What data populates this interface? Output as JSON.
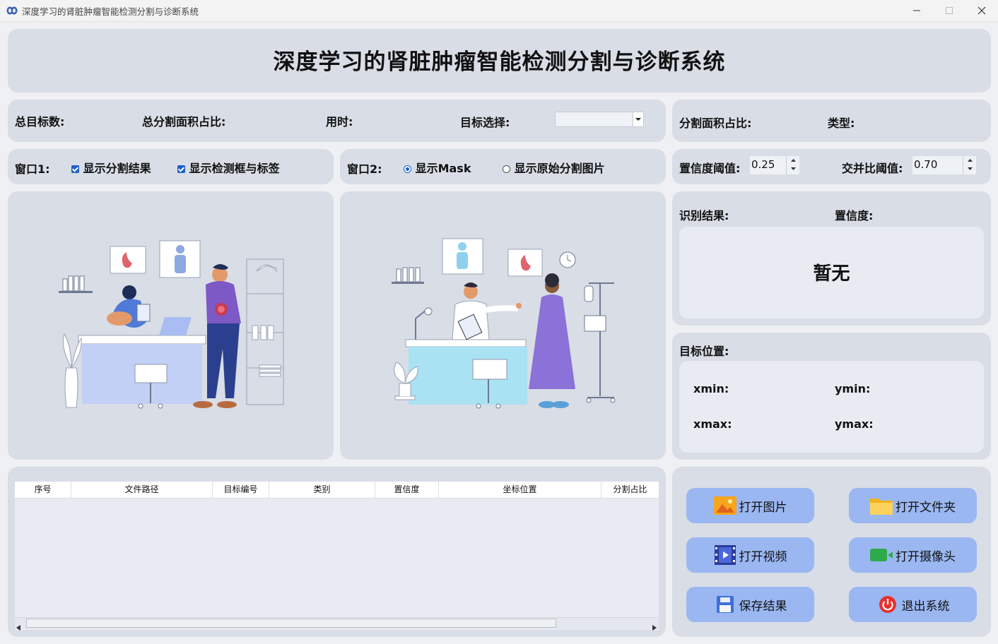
{
  "window": {
    "title": "深度学习的肾脏肿瘤智能检测分割与诊断系统"
  },
  "header": {
    "title": "深度学习的肾脏肿瘤智能检测分割与诊断系统"
  },
  "stats": {
    "total_targets": "总目标数:",
    "total_seg_ratio": "总分割面积占比:",
    "time_used": "用时:",
    "target_select": "目标选择:",
    "target_select_value": ""
  },
  "right_stats": {
    "seg_ratio": "分割面积占比:",
    "type": "类型:"
  },
  "window1": {
    "label": "窗口1:",
    "opt_seg": "显示分割结果",
    "opt_det": "显示检测框与标签",
    "seg_checked": true,
    "det_checked": true
  },
  "window2": {
    "label": "窗口2:",
    "opt_mask": "显示Mask",
    "opt_orig": "显示原始分割图片",
    "selected": "mask"
  },
  "thresholds": {
    "conf_label": "置信度阈值:",
    "conf_value": "0.25",
    "iou_label": "交并比阈值:",
    "iou_value": "0.70"
  },
  "result": {
    "label": "识别结果:",
    "conf_label": "置信度:",
    "value": "暂无"
  },
  "position": {
    "label": "目标位置:",
    "xmin": "xmin:",
    "ymin": "ymin:",
    "xmax": "xmax:",
    "ymax": "ymax:"
  },
  "table": {
    "columns": [
      "序号",
      "文件路径",
      "目标编号",
      "类别",
      "置信度",
      "坐标位置",
      "分割占比"
    ],
    "rows": []
  },
  "buttons": {
    "open_image": "打开图片",
    "open_folder": "打开文件夹",
    "open_video": "打开视频",
    "open_camera": "打开摄像头",
    "save_result": "保存结果",
    "exit": "退出系统"
  },
  "colors": {
    "panel": "#d8dde6",
    "button": "#9ab7f2",
    "accent": "#1e60c9"
  }
}
